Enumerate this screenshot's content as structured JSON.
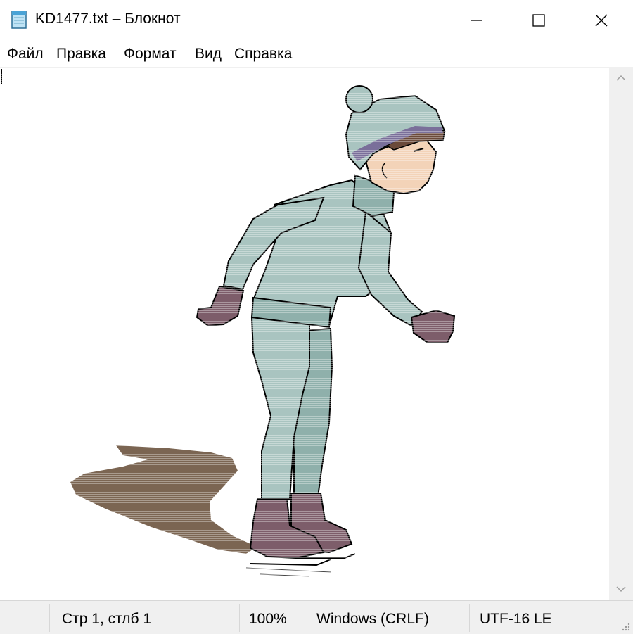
{
  "window": {
    "title": "KD1477.txt – Блокнот",
    "controls": {
      "minimize": "minimize-icon",
      "maximize": "maximize-icon",
      "close": "close-icon"
    }
  },
  "menu": {
    "items": [
      "Файл",
      "Правка",
      "Формат",
      "Вид",
      "Справка"
    ]
  },
  "editor": {
    "content": "ASCII-style color art of a boy ice skating"
  },
  "status": {
    "position": "Стр 1, стлб 1",
    "zoom": "100%",
    "line_endings": "Windows (CRLF)",
    "encoding": "UTF-16 LE"
  },
  "colors": {
    "suit": "#a9c4c0",
    "suit_shadow": "#7f9f9b",
    "mitten": "#7d5d6a",
    "skin": "#f3d3b8",
    "hair": "#6b4a3a",
    "shadow": "#7b6552",
    "hat_stripe": "#7a6f9a"
  }
}
